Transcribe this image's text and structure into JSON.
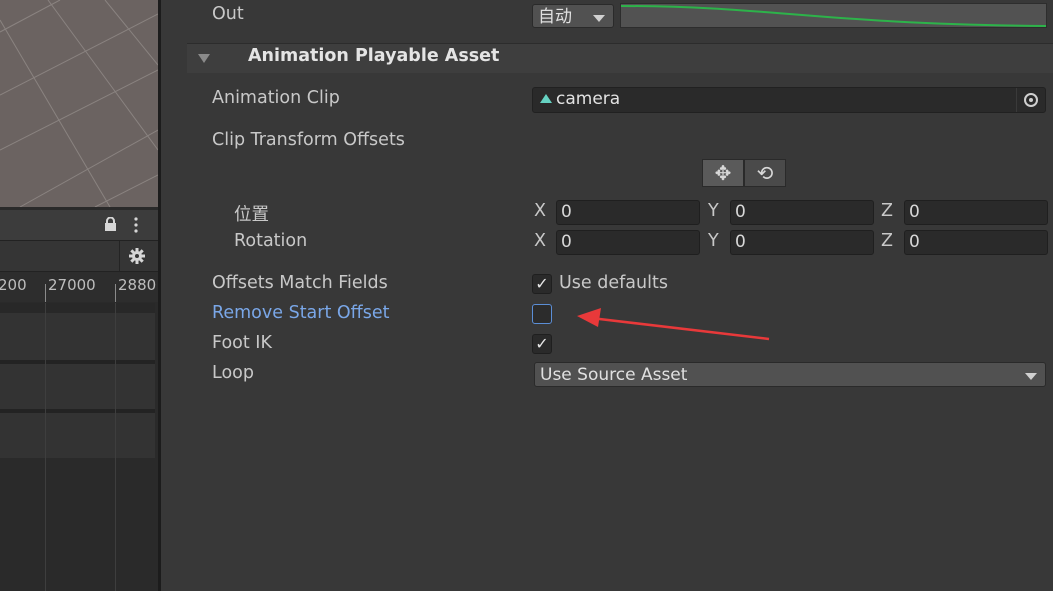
{
  "left_panel": {
    "ruler_labels": [
      "200",
      "27000",
      "2880"
    ]
  },
  "inspector": {
    "out": {
      "label": "Out",
      "value": "自动"
    },
    "section": {
      "title": "Animation Playable Asset"
    },
    "animation_clip": {
      "label": "Animation Clip",
      "value": "camera"
    },
    "clip_transform_offsets": {
      "label": "Clip Transform Offsets",
      "tools": [
        {
          "name": "move-tool",
          "glyph": "✥"
        },
        {
          "name": "rotate-tool",
          "glyph": "⟲"
        }
      ]
    },
    "position": {
      "label": "位置",
      "x_label": "X",
      "x": "0",
      "y_label": "Y",
      "y": "0",
      "z_label": "Z",
      "z": "0"
    },
    "rotation": {
      "label": "Rotation",
      "x_label": "X",
      "x": "0",
      "y_label": "Y",
      "y": "0",
      "z_label": "Z",
      "z": "0"
    },
    "offsets_match_fields": {
      "label": "Offsets Match Fields",
      "checked": true,
      "option_label": "Use defaults"
    },
    "remove_start_offset": {
      "label": "Remove Start Offset",
      "checked": false
    },
    "foot_ik": {
      "label": "Foot IK",
      "checked": true
    },
    "loop": {
      "label": "Loop",
      "value": "Use Source Asset"
    }
  },
  "colors": {
    "background": "#383838",
    "highlight_label": "#7aa7e8",
    "annotation_arrow": "#e8393a",
    "curve": "#2db34a",
    "clip_icon": "#66d2c2"
  }
}
